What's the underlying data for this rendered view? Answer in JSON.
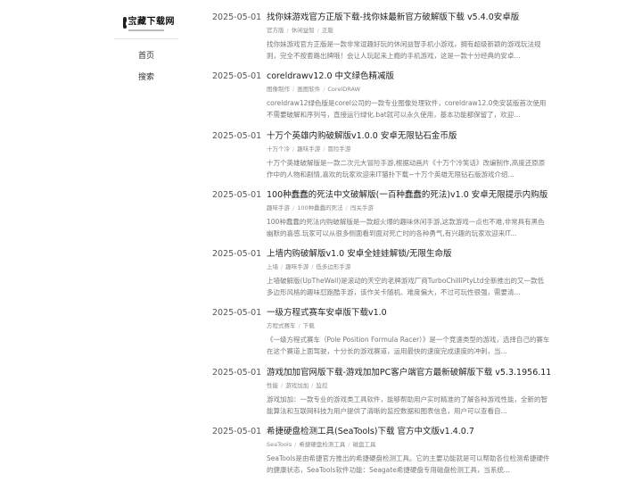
{
  "site": {
    "logo_text": "宝藏下载网"
  },
  "nav": [
    {
      "label": "首页"
    },
    {
      "label": "搜索"
    }
  ],
  "posts": [
    {
      "date": "2025-05-01",
      "title": "找你妹游戏官方正版下载-找你妹最新官方破解版下载 v5.4.0安卓版",
      "tags": [
        "官方版",
        "休闲益智",
        "正版"
      ],
      "desc": "找你妹游戏官方正版是一款非常逗趣好玩的休闲益智手机小游戏，拥有超级新颖的游戏玩法规则，完全不按套路出牌哦！会让人玩起来上瘾的手机游戏，这是一款十分经典的安卓..."
    },
    {
      "date": "2025-05-01",
      "title": "coreldrawv12.0 中文绿色精减版",
      "tags": [
        "图像制作",
        "画图软件",
        "CorelDRAW"
      ],
      "desc": "coreldraw12绿色版是corel公司的一款专业图像处理软件，coreldraw12.0免安装版首次使用不需要破解和序列号，直接运行绿化.bat就可以永久使用，基本功能都保留了，欢迎..."
    },
    {
      "date": "2025-05-01",
      "title": "十万个英雄内购破解版v1.0.0 安卓无限钻石金币版",
      "tags": [
        "十万个冷",
        "趣味手游",
        "冒险手游"
      ],
      "desc": "十万个英雄破解版是一款二次元大冒险手游,根据动画片《十万个冷笑话》改编制作,高度还原原作中的人物和剧情,喜欢的玩家欢迎来IT猫扑下载~十万个英雄无限钻石版游戏介绍..."
    },
    {
      "date": "2025-05-01",
      "title": "100种蠢蠢的死法中文破解版(一百种蠢蠢的死法)v1.0 安卓无限提示内购版",
      "tags": [
        "趣味手游",
        "100种蠢蠢的死法",
        "闯关手游"
      ],
      "desc": "100种蠢蠢的死法内购破解版是一款超火爆的趣味休闲手游,这款游戏一点也不难,非常具有黑色幽默的喜感.玩家可以从很多侧面看到面对死亡时的各种勇气,有兴趣的玩家欢迎来IT..."
    },
    {
      "date": "2025-05-01",
      "title": "上墙内购破解版v1.0 安卓全娃娃解锁/无限生命版",
      "tags": [
        "上墙",
        "趣味手游",
        "低多边形手游"
      ],
      "desc": "上墙破解版(UpTheWall)是滚动的天空的老牌游戏厂商TurboChilliPtyLtd全新推出的又一款低多边形风格的趣味怼跑酷手游，该作关卡随机、难度偏大，不过可玩性很强，需要清..."
    },
    {
      "date": "2025-05-01",
      "title": "一级方程式赛车安卓版下载v1.0",
      "tags": [
        "方程式赛车",
        "下载"
      ],
      "desc": "《一级方程式赛车（Pole Position Formula Racer）》是一个竞速类型的游戏，选择自己的赛车在这个赛道上面驾驶，十分长的游戏赛道，运用最快的速度完成速度的冲刺，当..."
    },
    {
      "date": "2025-05-01",
      "title": "游戏加加官网版下载-游戏加加PC客户端官方最新破解版下载 v5.3.1956.111",
      "tags": [
        "性能",
        "游戏加加",
        "监控"
      ],
      "desc": "游戏加加：一款专业的游戏类工具软件，能够帮助用户实时精准的了解各种游戏性能，全新的智能算法和互联网科技为用户提供了清晰的监控数据和图表信息，用户可以查看自..."
    },
    {
      "date": "2025-05-01",
      "title": "希捷硬盘检测工具(SeaTools)下载 官方中文版v1.4.0.7",
      "tags": [
        "SeaTools",
        "希捷硬盘检测工具",
        "磁盘工具"
      ],
      "desc": "SeaTools是由希捷官方推出的希捷硬盘检测工具。它的主要功能就是可以帮助各位检测希捷硬件的健康状态，SeaTools软件功能：Seagate希捷硬盘专用磁盘检测工具，当系统..."
    }
  ]
}
